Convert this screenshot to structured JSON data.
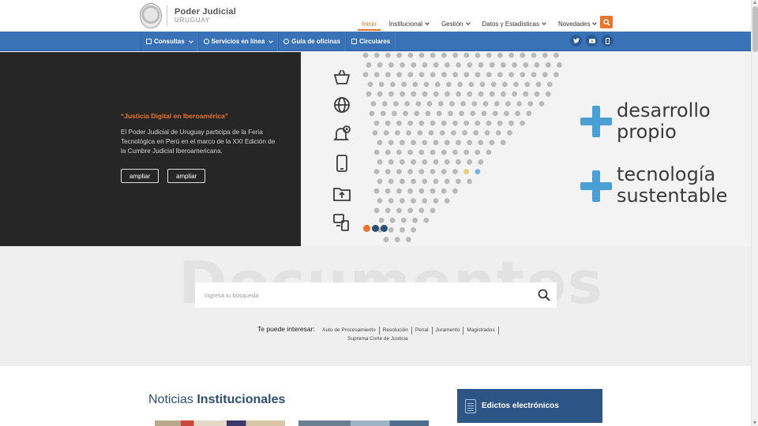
{
  "header": {
    "logo_title": "Poder Judicial",
    "logo_subtitle": "URUGUAY",
    "nav": [
      {
        "label": "Inicio",
        "active": true,
        "dropdown": false
      },
      {
        "label": "Institucional",
        "active": false,
        "dropdown": true
      },
      {
        "label": "Gestión",
        "active": false,
        "dropdown": true
      },
      {
        "label": "Datos y Estadísticas",
        "active": false,
        "dropdown": true
      },
      {
        "label": "Novedades",
        "active": false,
        "dropdown": true
      }
    ],
    "search_icon": "search-icon"
  },
  "subnav": {
    "items": [
      {
        "label": "Consultas",
        "icon": "document-icon",
        "dropdown": true
      },
      {
        "label": "Servicios en línea",
        "icon": "chat-icon",
        "dropdown": true
      },
      {
        "label": "Guía de oficinas",
        "icon": "users-icon",
        "dropdown": false
      },
      {
        "label": "Circulares",
        "icon": "copy-icon",
        "dropdown": false
      }
    ],
    "socials": [
      {
        "name": "twitter-icon"
      },
      {
        "name": "youtube-icon"
      },
      {
        "name": "mobile-icon"
      }
    ]
  },
  "hero": {
    "title": "“Justicia Digital en Iberoamérica”",
    "text": "El Poder Judicial de Uruguay participa de la Feria Tecnológica en Perú en el marco de la XXI Edición de la Cumbre Judicial Iberoamericana.",
    "buttons": [
      "ampliar",
      "ampliar"
    ],
    "slide_text_1": [
      "desarrollo",
      "propio"
    ],
    "slide_text_2": [
      "tecnología",
      "sustentable"
    ],
    "slide_icons": [
      "basket-icon",
      "globe-icon",
      "bell-clock-icon",
      "tablet-icon",
      "folder-upload-icon",
      "devices-icon"
    ],
    "carousel": {
      "count": 3,
      "active": 0
    }
  },
  "documents": {
    "watermark": "Documentos",
    "search_placeholder": "Ingresá tu búsqueda",
    "interest_label": "Te puede interesar:",
    "tags": [
      "Auto de Procesamiento",
      "Resolución",
      "Penal",
      "Juramento",
      "Magistrados"
    ],
    "tag_second_row": "Suprema Corte de Justicia"
  },
  "news": {
    "title_light": "Noticias",
    "title_bold": "Institucionales"
  },
  "edictos": {
    "label": "Edictos electrónicos"
  },
  "colors": {
    "accent": "#e8732a",
    "nav_blue": "#3a72b7",
    "dark_blue": "#2d5686",
    "hero_dark": "#262626",
    "slide_cross": "#4a9fd4"
  }
}
